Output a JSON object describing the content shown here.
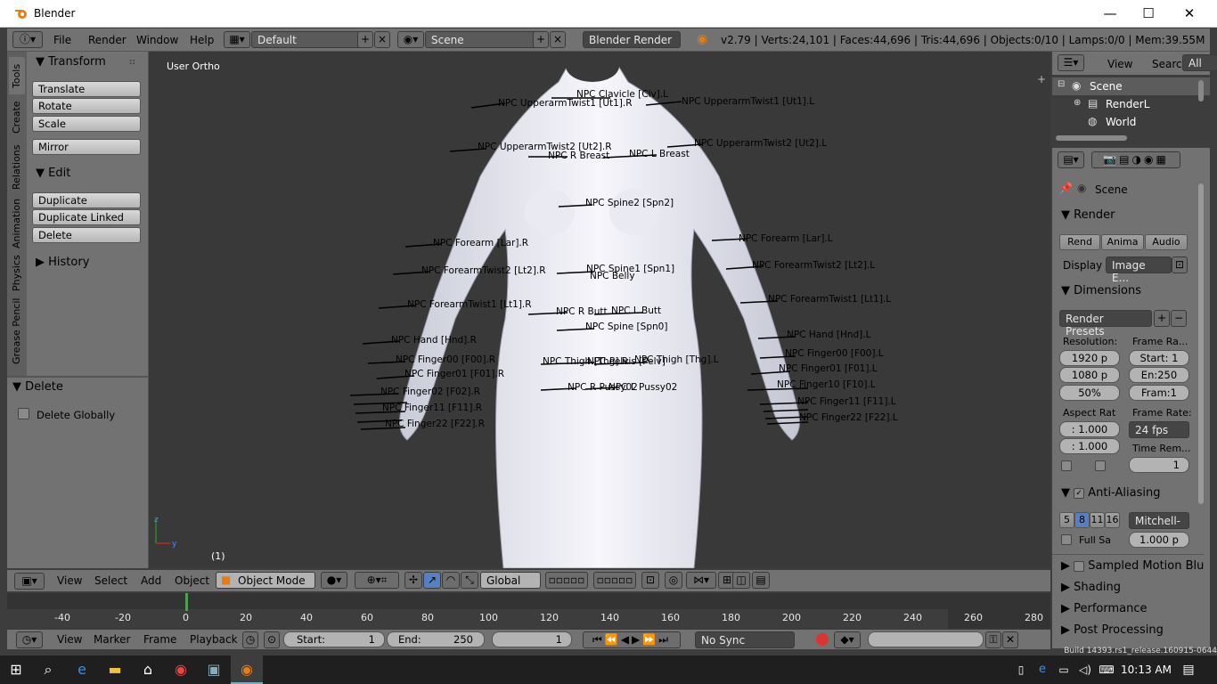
{
  "window": {
    "title": "Blender",
    "min": "—",
    "max": "☐",
    "close": "✕"
  },
  "infobar": {
    "menus": [
      "File",
      "Render",
      "Window",
      "Help"
    ],
    "layout": "Default",
    "scene": "Scene",
    "engine": "Blender Render",
    "stats": "v2.79 | Verts:24,101 | Faces:44,696 | Tris:44,696 | Objects:0/10 | Lamps:0/0 | Mem:39.55M"
  },
  "toolshelf": {
    "tabs": [
      "Tools",
      "Create",
      "Relations",
      "Animation",
      "Physics",
      "Grease Pencil"
    ],
    "transform_title": "Transform",
    "transform_buttons": [
      "Translate",
      "Rotate",
      "Scale"
    ],
    "mirror": "Mirror",
    "edit_title": "Edit",
    "edit_buttons": [
      "Duplicate",
      "Duplicate Linked",
      "Delete"
    ],
    "history_title": "History",
    "operator_title": "Delete",
    "operator_option": "Delete Globally"
  },
  "viewport": {
    "label": "User Ortho",
    "frame": "(1)",
    "bones": [
      "NPC Clavicle [Clv].L",
      "NPC UpperarmTwist1 [Ut1].R",
      "NPC UpperarmTwist1 [Ut1].L",
      "NPC UpperarmTwist2 [Ut2].R",
      "NPC UpperarmTwist2 [Ut2].L",
      "NPC R Breast",
      "NPC L Breast",
      "NPC Spine2 [Spn2]",
      "NPC Forearm [Lar].R",
      "NPC Forearm [Lar].L",
      "NPC ForearmTwist2 [Lt2].R",
      "NPC ForearmTwist2 [Lt2].L",
      "NPC Spine1 [Spn1]",
      "NPC Belly",
      "NPC ForearmTwist1 [Lt1].R",
      "NPC ForearmTwist1 [Lt1].L",
      "NPC R Butt",
      "NPC L Butt",
      "NPC Spine [Spn0]",
      "NPC Hand [Hnd].R",
      "NPC Hand [Hnd].L",
      "NPC Finger00 [F00].R",
      "NPC Finger00 [F00].L",
      "NPC Thigh [Thg].R",
      "NPC Pelvis [Pelv]",
      "NPC Thigh [Thg].L",
      "NPC Finger01 [F01].R",
      "NPC Finger01 [F01].L",
      "NPC R Pussy02",
      "NPC L Pussy02",
      "NPC Finger02 [F02].R",
      "NPC Finger10 [F10].L",
      "NPC Finger11 [F11].R",
      "NPC Finger11 [F11].L",
      "NPC Finger22 [F22].R",
      "NPC Finger22 [F22].L"
    ]
  },
  "vpheader": {
    "menus": [
      "View",
      "Select",
      "Add",
      "Object"
    ],
    "mode": "Object Mode",
    "orientation": "Global"
  },
  "timeline": {
    "ticks": [
      "-40",
      "-20",
      "0",
      "20",
      "40",
      "60",
      "80",
      "100",
      "120",
      "140",
      "160",
      "180",
      "200",
      "220",
      "240",
      "260",
      "280"
    ],
    "menus": [
      "View",
      "Marker",
      "Frame",
      "Playback"
    ],
    "start_label": "Start:",
    "start": "1",
    "end_label": "End:",
    "end": "250",
    "current": "1",
    "sync": "No Sync"
  },
  "outliner": {
    "menus": [
      "View",
      "Search"
    ],
    "filter": "All Sc",
    "items": [
      "Scene",
      "RenderL",
      "World"
    ]
  },
  "properties": {
    "context": "Scene",
    "render_title": "Render",
    "render_buttons": [
      "Rend",
      "Anima",
      "Audio"
    ],
    "display_label": "Display",
    "display_value": "Image E...",
    "dimensions_title": "Dimensions",
    "presets": "Render Presets",
    "resolution_label": "Resolution:",
    "res_x": "1920 p",
    "res_y": "1080 p",
    "res_pct": "50%",
    "frame_range_label": "Frame Ra...",
    "frame_start": "Start: 1",
    "frame_end": "En:250",
    "frame_step": "Fram:1",
    "aspect_label": "Aspect Rat",
    "aspect_x": ": 1.000",
    "aspect_y": ": 1.000",
    "fps_label": "Frame Rate:",
    "fps": "24 fps",
    "time_remap_label": "Time Rem...",
    "time_remap": "1",
    "aa_title": "Anti-Aliasing",
    "aa_samples": [
      "5",
      "8",
      "11",
      "16"
    ],
    "aa_filter": "Mitchell-",
    "full_sample": "Full Sa",
    "filter_size": "1.000 p",
    "panels": [
      "Sampled Motion Blur",
      "Shading",
      "Performance",
      "Post Processing"
    ]
  },
  "taskbar": {
    "time": "10:13 AM",
    "build": "Build 14393.rs1_release.160915-0644"
  },
  "colors": {
    "active_sample": "#5680c2",
    "timeline_cursor": "#4aa34a"
  }
}
